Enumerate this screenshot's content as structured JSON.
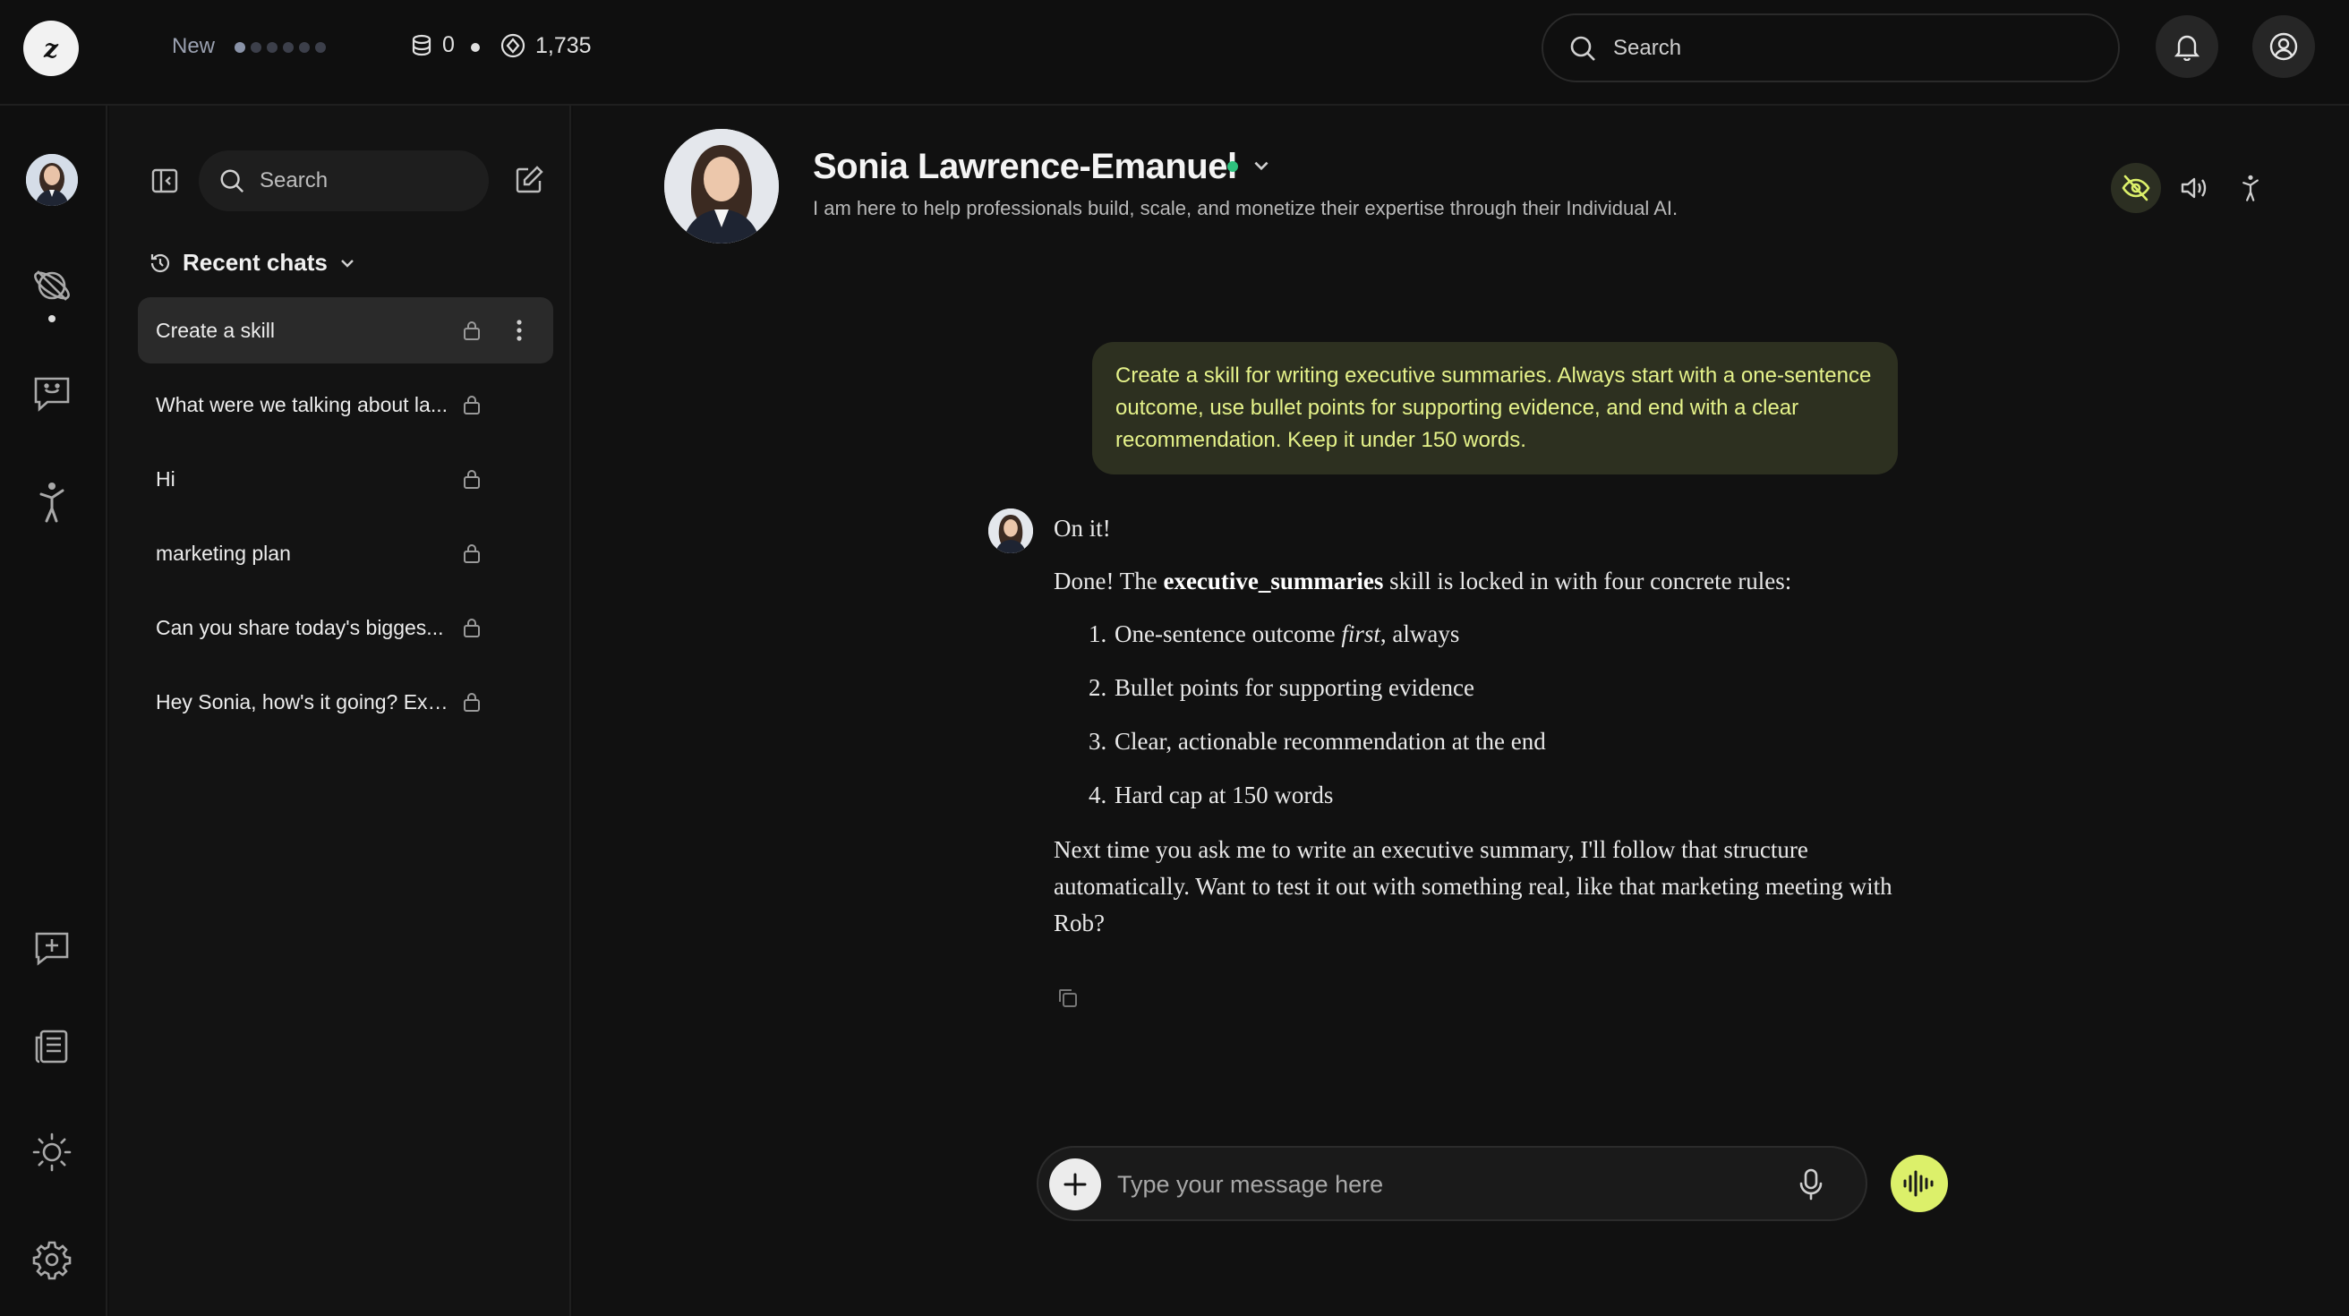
{
  "app": {
    "logo_text": "z",
    "new_label": "New",
    "progress_dots": {
      "filled": 1,
      "total": 6
    },
    "stat_a": "0",
    "stat_b": "1,735",
    "search_placeholder": "Search"
  },
  "rail": {
    "icons": [
      "agent-avatar",
      "explore-icon",
      "chat-bubble-icon",
      "accessibility-figure-icon",
      "new-feedback-icon",
      "news-icon",
      "theme-sun-icon",
      "settings-gear-icon"
    ]
  },
  "sidebar": {
    "search_placeholder": "Search",
    "recent_label": "Recent chats",
    "chats": [
      {
        "title": "Create a skill",
        "active": true
      },
      {
        "title": "What were we talking about la...",
        "active": false
      },
      {
        "title": "Hi",
        "active": false
      },
      {
        "title": "marketing plan",
        "active": false
      },
      {
        "title": "Can you share today's bigges...",
        "active": false
      },
      {
        "title": "Hey Sonia, how's it going? Exc...",
        "active": false
      }
    ]
  },
  "agent": {
    "name": "Sonia Lawrence-Emanuel",
    "description": "I am here to help professionals build, scale, and monetize their expertise through their Individual AI.",
    "status_color": "#2ec27e"
  },
  "conversation": {
    "user_message": "Create a skill for writing executive summaries. Always start with a one-sentence outcome, use bullet points for supporting evidence, and end with a clear recommendation. Keep it under 150 words.",
    "bot_intro": "On it!",
    "bot_done_prefix": "Done! The ",
    "bot_skill_name": "executive_summaries",
    "bot_done_suffix": " skill is locked in with four concrete rules:",
    "rule1_prefix": "One-sentence outcome ",
    "rule1_em": "first",
    "rule1_suffix": ", always",
    "rules_rest": [
      "Bullet points for supporting evidence",
      "Clear, actionable recommendation at the end",
      "Hard cap at 150 words"
    ],
    "bot_closing": "Next time you ask me to write an executive summary, I'll follow that structure automatically. Want to test it out with something real, like that marketing meeting with Rob?"
  },
  "composer": {
    "placeholder": "Type your message here"
  },
  "colors": {
    "accent": "#dcf06a",
    "user_bubble_bg": "#2d3020",
    "user_bubble_text": "#e5f28a"
  }
}
